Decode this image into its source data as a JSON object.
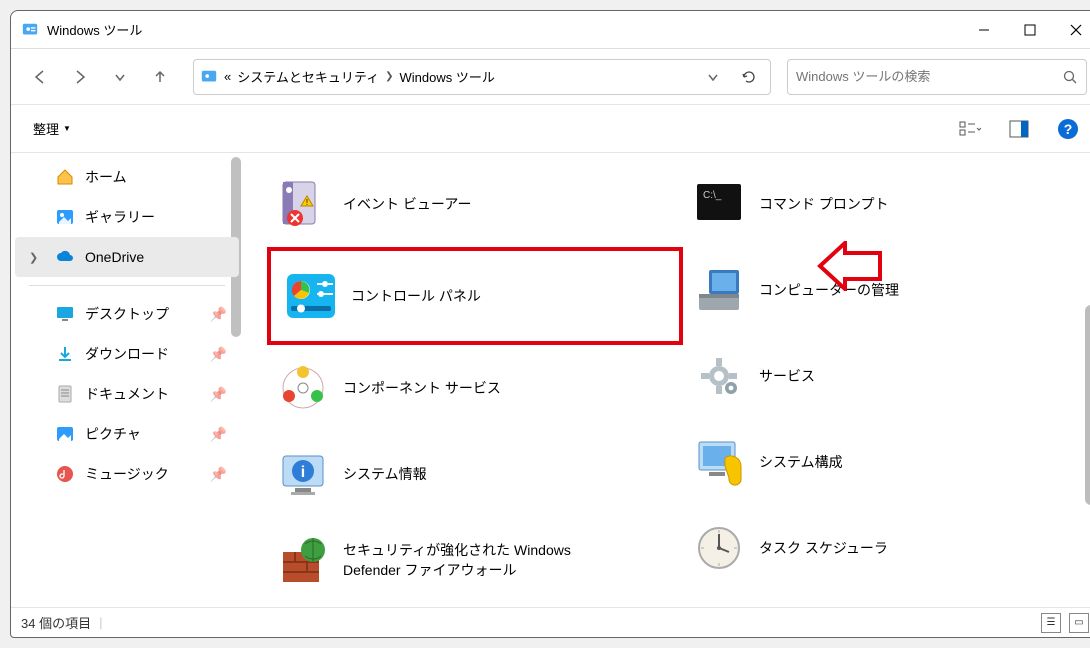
{
  "window": {
    "title": "Windows ツール"
  },
  "breadcrumb": {
    "parts": [
      "«",
      "システムとセキュリティ",
      "Windows ツール"
    ]
  },
  "search": {
    "placeholder": "Windows ツールの検索"
  },
  "toolbar": {
    "organize": "整理"
  },
  "sidebar": {
    "items": [
      {
        "label": "ホーム",
        "type": "home"
      },
      {
        "label": "ギャラリー",
        "type": "gallery"
      },
      {
        "label": "OneDrive",
        "type": "onedrive",
        "selected": true,
        "chevron": true
      },
      {
        "label": "デスクトップ",
        "type": "desktop",
        "pinned": true
      },
      {
        "label": "ダウンロード",
        "type": "downloads",
        "pinned": true
      },
      {
        "label": "ドキュメント",
        "type": "documents",
        "pinned": true
      },
      {
        "label": "ピクチャ",
        "type": "pictures",
        "pinned": true
      },
      {
        "label": "ミュージック",
        "type": "music",
        "pinned": true
      }
    ]
  },
  "content": {
    "col1": [
      {
        "label": "イベント ビューアー",
        "icon": "event-viewer"
      },
      {
        "label": "コントロール パネル",
        "icon": "control-panel",
        "highlighted": true
      },
      {
        "label": "コンポーネント サービス",
        "icon": "component-services"
      },
      {
        "label": "システム情報",
        "icon": "system-info"
      },
      {
        "label": "セキュリティが強化された Windows Defender ファイアウォール",
        "icon": "firewall"
      }
    ],
    "col2": [
      {
        "label": "コマンド プロンプト",
        "icon": "cmd"
      },
      {
        "label": "コンピューターの管理",
        "icon": "computer-mgmt"
      },
      {
        "label": "サービス",
        "icon": "services"
      },
      {
        "label": "システム構成",
        "icon": "msconfig"
      },
      {
        "label": "タスク スケジューラ",
        "icon": "task-scheduler"
      }
    ]
  },
  "status": {
    "count": "34 個の項目"
  }
}
